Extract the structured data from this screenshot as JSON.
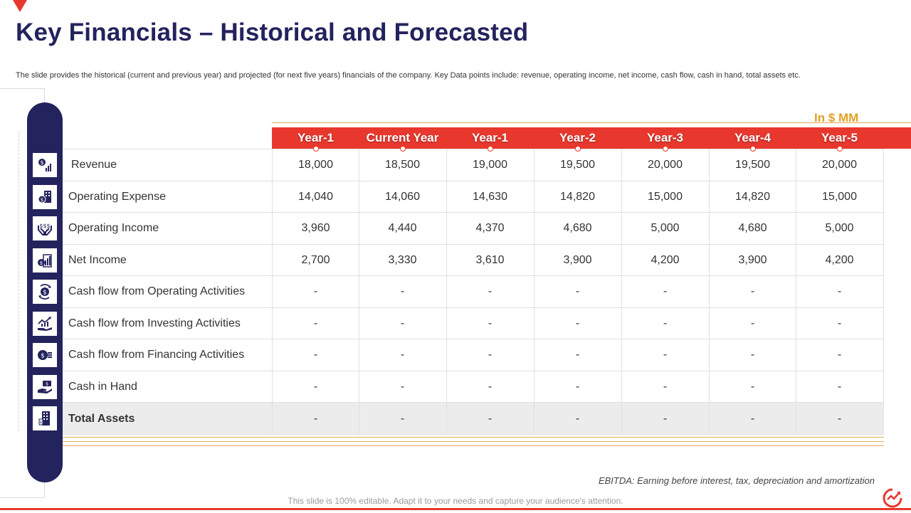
{
  "header": {
    "title": "Key Financials – Historical and Forecasted",
    "subtitle": "The slide provides the historical (current and previous year) and projected (for next five years) financials of the company. Key Data points include: revenue, operating income, net income, cash flow, cash in hand, total assets etc."
  },
  "table": {
    "unit_label": "In $ MM",
    "columns": [
      "Year-1",
      "Current Year",
      "Year-1",
      "Year-2",
      "Year-3",
      "Year-4",
      "Year-5"
    ],
    "rows": [
      {
        "label": "Revenue",
        "icon": "dollar-chart-icon",
        "values": [
          "18,000",
          "18,500",
          "19,000",
          "19,500",
          "20,000",
          "19,500",
          "20,000"
        ]
      },
      {
        "label": "Operating Expense",
        "icon": "dollar-building-icon",
        "values": [
          "14,040",
          "14,060",
          "14,630",
          "14,820",
          "15,000",
          "14,820",
          "15,000"
        ]
      },
      {
        "label": "Operating Income",
        "icon": "hands-dollar-icon",
        "values": [
          "3,960",
          "4,440",
          "4,370",
          "4,680",
          "5,000",
          "4,680",
          "5,000"
        ]
      },
      {
        "label": "Net Income",
        "icon": "dollar-bars-icon",
        "values": [
          "2,700",
          "3,330",
          "3,610",
          "3,900",
          "4,200",
          "3,900",
          "4,200"
        ]
      },
      {
        "label": "Cash flow from Operating Activities",
        "icon": "dollar-cycle-icon",
        "values": [
          "-",
          "-",
          "-",
          "-",
          "-",
          "-",
          "-"
        ]
      },
      {
        "label": "Cash flow from Investing Activities",
        "icon": "hand-growth-icon",
        "values": [
          "-",
          "-",
          "-",
          "-",
          "-",
          "-",
          "-"
        ]
      },
      {
        "label": "Cash flow from Financing Activities",
        "icon": "coins-exchange-icon",
        "values": [
          "-",
          "-",
          "-",
          "-",
          "-",
          "-",
          "-"
        ]
      },
      {
        "label": "Cash in Hand",
        "icon": "hand-cash-icon",
        "values": [
          "-",
          "-",
          "-",
          "-",
          "-",
          "-",
          "-"
        ]
      },
      {
        "label": "Total Assets",
        "icon": "building-dollar-icon",
        "values": [
          "-",
          "-",
          "-",
          "-",
          "-",
          "-",
          "-"
        ]
      }
    ]
  },
  "footer": {
    "footnote": "EBITDA: Earning before interest, tax, depreciation and amortization",
    "disclaimer": "This slide is 100% editable. Adapt it to your needs and capture your audience's attention."
  },
  "colors": {
    "navy": "#23235e",
    "accent_red": "#e8382e",
    "gold": "#e3a021"
  }
}
